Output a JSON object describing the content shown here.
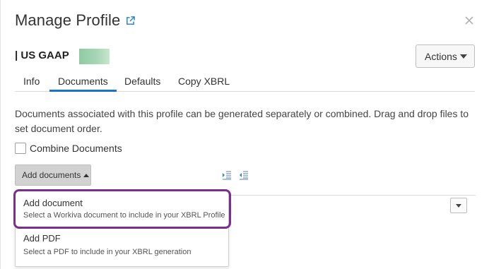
{
  "dialog": {
    "title": "Manage Profile",
    "profile_name": "| US GAAP",
    "actions_label": "Actions"
  },
  "tabs": [
    {
      "label": "Info",
      "active": false
    },
    {
      "label": "Documents",
      "active": true
    },
    {
      "label": "Defaults",
      "active": false
    },
    {
      "label": "Copy XBRL",
      "active": false
    }
  ],
  "documents": {
    "description": "Documents associated with this profile can be generated separately or combined. Drag and drop files to set document order.",
    "combine_label": "Combine Documents",
    "combine_checked": false,
    "add_documents_label": "Add documents"
  },
  "menu": {
    "items": [
      {
        "label": "Add document",
        "sublabel": "Select a Workiva document to include in your XBRL Profile"
      },
      {
        "label": "Add PDF",
        "sublabel": "Select a PDF to include in your XBRL generation"
      }
    ]
  },
  "colors": {
    "accent_tab": "#1a73c8",
    "highlight": "#7a2e8e",
    "name_swatch": "#a8d7b5",
    "external_link": "#2e86d1"
  }
}
